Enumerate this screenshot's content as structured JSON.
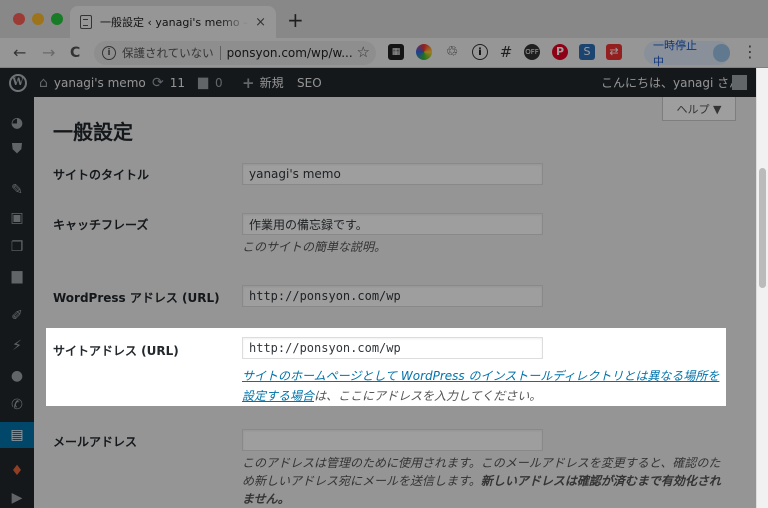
{
  "browser": {
    "tab_title": "一般設定 ‹ yanagi's memo — WordPress",
    "tab_close": "×",
    "new_tab": "+",
    "security_warning": "保護されていない",
    "url": "ponsyon.com/wp/w...",
    "paused_label": "一時停止中",
    "nav_back": "←",
    "nav_forward": "→",
    "nav_reload": "C"
  },
  "adminbar": {
    "site_name": "yanagi's memo",
    "updates_count": "11",
    "comments_count": "0",
    "new_label": "新規",
    "seo_label": "SEO",
    "greeting": "こんにちは、yanagi さん"
  },
  "help": {
    "label": "ヘルプ ▼"
  },
  "page": {
    "title": "一般設定",
    "fields": {
      "site_title": {
        "label": "サイトのタイトル",
        "value": "yanagi's memo"
      },
      "tagline": {
        "label": "キャッチフレーズ",
        "value": "作業用の備忘録です。",
        "description": "このサイトの簡単な説明。"
      },
      "wp_address": {
        "label": "WordPress アドレス (URL)",
        "value": "http://ponsyon.com/wp"
      },
      "site_address": {
        "label": "サイトアドレス (URL)",
        "value": "http://ponsyon.com/wp",
        "link_line1": "サイトのホームページとして WordPress のインストールディレクトリとは異なる場所を",
        "link_line2": "設定する場合",
        "desc_rest": "は、ここにアドレスを入力してください。"
      },
      "email": {
        "label": "メールアドレス",
        "value": "",
        "desc_line1": "このアドレスは管理のために使用されます。このメールアドレスを変更すると、確認のた",
        "desc_line2_a": "め新しいアドレス宛にメールを送信します。",
        "desc_line2_b": "新しいアドレスは確認が済むまで有効化され",
        "desc_line3": "ません。"
      }
    }
  },
  "colors": {
    "admin_bar": "#23282d",
    "accent": "#0073aa",
    "background": "#f1f1f1"
  }
}
